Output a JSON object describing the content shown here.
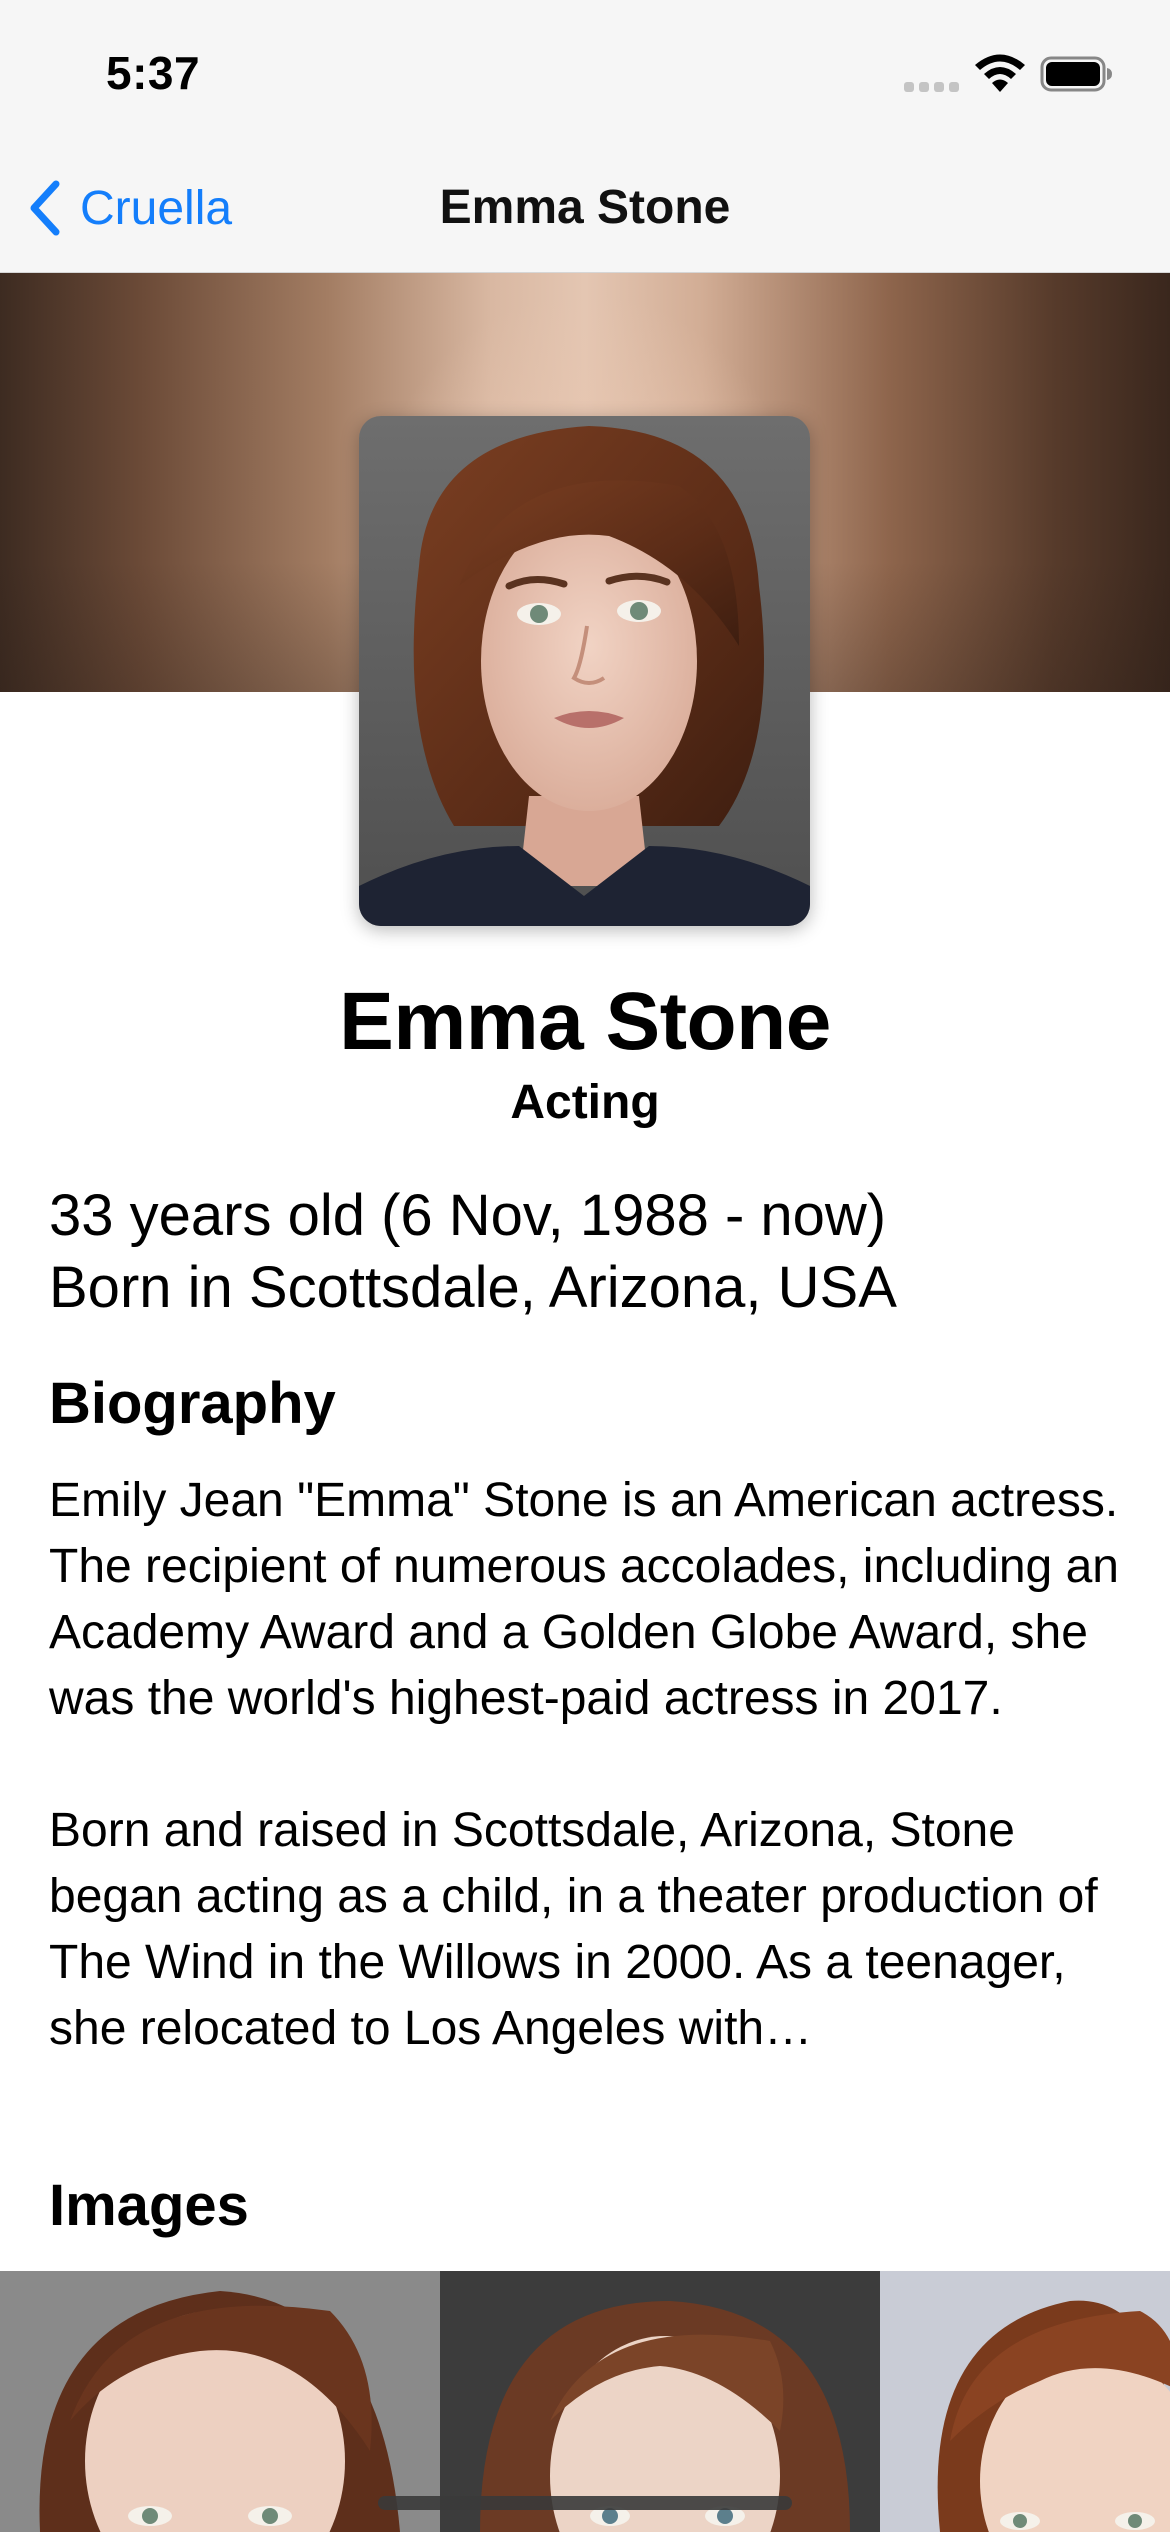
{
  "status_bar": {
    "time": "5:37"
  },
  "nav": {
    "back_label": "Cruella",
    "title": "Emma Stone"
  },
  "person": {
    "name": "Emma Stone",
    "role": "Acting",
    "age_line": "33 years old (6 Nov, 1988 - now)",
    "birthplace_line": "Born in Scottsdale, Arizona, USA"
  },
  "biography": {
    "heading": "Biography",
    "text": "Emily Jean \"Emma\" Stone is an American actress. The recipient of numerous accolades, including an Academy Award and a Golden Globe Award, she was the world's highest-paid actress in 2017.\n\nBorn and raised in Scottsdale, Arizona, Stone began acting as a child, in a theater production of The Wind in the Willows in 2000. As a teenager, she relocated to Los Angeles with…"
  },
  "images": {
    "heading": "Images"
  },
  "colors": {
    "accent": "#147efb",
    "bar_background": "#f6f6f6"
  }
}
